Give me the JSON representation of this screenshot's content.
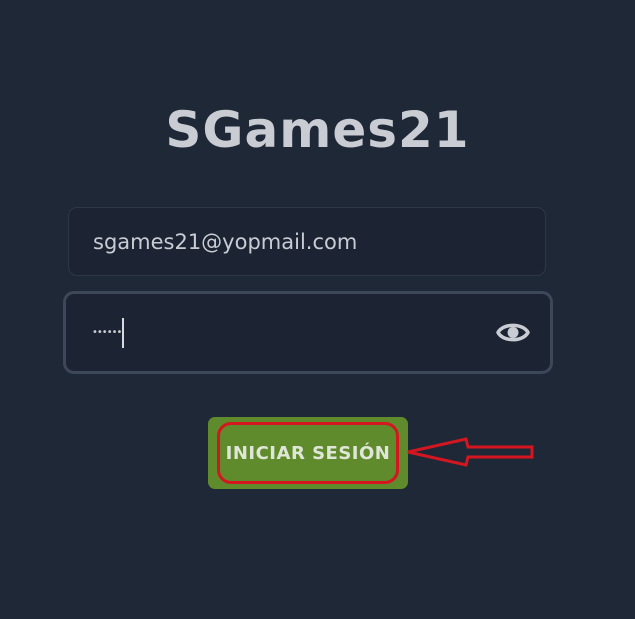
{
  "brand": {
    "logo_text": "SGames21"
  },
  "login_form": {
    "email_value": "sgames21@yopmail.com",
    "password_masked": "••••••",
    "show_password_icon": "eye-icon",
    "submit_label": "INICIAR SESIÓN"
  },
  "annotation": {
    "highlight_color": "#d3161f",
    "arrow_points_to": "submit button"
  },
  "colors": {
    "background": "#1f2837",
    "field_background": "#1c2433",
    "button_background": "#5f8b2c",
    "text": "#c9ccd3"
  }
}
